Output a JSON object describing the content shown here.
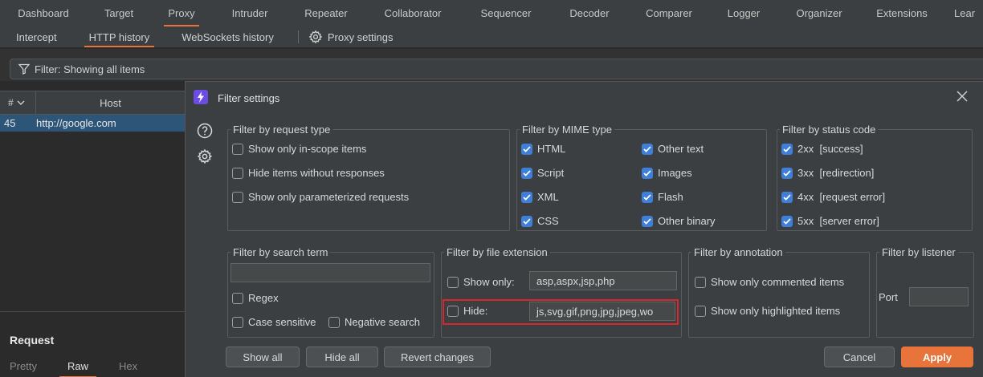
{
  "top_tabs": [
    "Dashboard",
    "Target",
    "Proxy",
    "Intruder",
    "Repeater",
    "Collaborator",
    "Sequencer",
    "Decoder",
    "Comparer",
    "Logger",
    "Organizer",
    "Extensions",
    "Lear"
  ],
  "top_active": "Proxy",
  "sub_tabs": {
    "intercept": "Intercept",
    "http_history": "HTTP history",
    "websockets_history": "WebSockets history",
    "proxy_settings": "Proxy settings"
  },
  "filter_bar": {
    "label": "Filter: Showing all items"
  },
  "table": {
    "col_num": "#",
    "col_host": "Host",
    "rows": [
      {
        "num": "45",
        "host": "http://google.com"
      }
    ]
  },
  "request_panel": {
    "title": "Request",
    "tabs": {
      "pretty": "Pretty",
      "raw": "Raw",
      "hex": "Hex"
    }
  },
  "dialog": {
    "title": "Filter settings",
    "request_type": {
      "legend": "Filter by request type",
      "in_scope": "Show only in-scope items",
      "without_responses": "Hide items without responses",
      "parameterized": "Show only parameterized requests"
    },
    "mime_type": {
      "legend": "Filter by MIME type",
      "html": "HTML",
      "script": "Script",
      "xml": "XML",
      "css": "CSS",
      "other_text": "Other text",
      "images": "Images",
      "flash": "Flash",
      "other_binary": "Other binary"
    },
    "status_code": {
      "legend": "Filter by status code",
      "s2xx": "2xx  [success]",
      "s3xx": "3xx  [redirection]",
      "s4xx": "4xx  [request error]",
      "s5xx": "5xx  [server error]"
    },
    "search_term": {
      "legend": "Filter by search term",
      "value": "",
      "regex": "Regex",
      "case_sensitive": "Case sensitive",
      "negative": "Negative search"
    },
    "file_extension": {
      "legend": "Filter by file extension",
      "show_only_label": "Show only:",
      "show_only_value": "asp,aspx,jsp,php",
      "hide_label": "Hide:",
      "hide_value": "js,svg,gif,png,jpg,jpeg,wo"
    },
    "annotation": {
      "legend": "Filter by annotation",
      "commented": "Show only commented items",
      "highlighted": "Show only highlighted items"
    },
    "listener": {
      "legend": "Filter by listener",
      "port_label": "Port",
      "port_value": ""
    },
    "buttons": {
      "show_all": "Show all",
      "hide_all": "Hide all",
      "revert": "Revert changes",
      "cancel": "Cancel",
      "apply": "Apply"
    }
  }
}
